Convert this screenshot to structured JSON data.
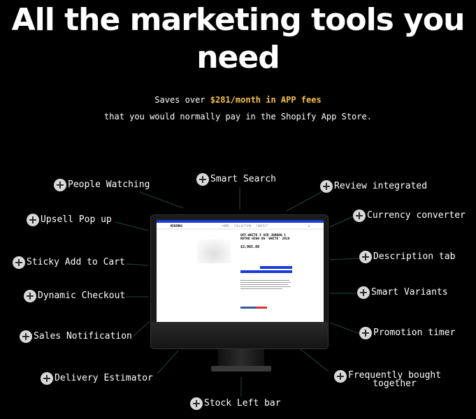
{
  "heading": "All the marketing tools you need",
  "savings": {
    "prefix": "Saves over ",
    "highlight": "$281/month in APP fees",
    "line2": "that you would normally pay in the Shopify App Store."
  },
  "accent_color": "#f5c04a",
  "screen": {
    "title": "OFF-WHITE X AIR JORDAN 1 RETRO HIGH OG 'WHITE' 2018",
    "price": "$3,985.00"
  },
  "features": [
    {
      "label": "People Watching"
    },
    {
      "label": "Smart Search"
    },
    {
      "label": "Review integrated"
    },
    {
      "label": "Upsell Pop up"
    },
    {
      "label": "Currency converter"
    },
    {
      "label": "Sticky Add to Cart"
    },
    {
      "label": "Description tab"
    },
    {
      "label": "Dynamic Checkout"
    },
    {
      "label": "Smart Variants"
    },
    {
      "label": "Sales Notification"
    },
    {
      "label": "Promotion timer"
    },
    {
      "label": "Delivery Estimator"
    },
    {
      "label": "Frequently bought\ntogether"
    },
    {
      "label": "Stock Left bar"
    }
  ]
}
